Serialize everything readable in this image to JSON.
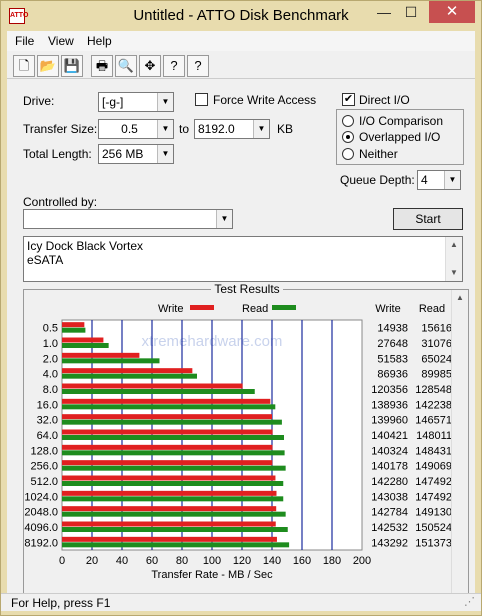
{
  "window": {
    "title": "Untitled - ATTO Disk Benchmark",
    "app_icon_label": "ATTO",
    "minimize_glyph": "—",
    "maximize_glyph": "☐",
    "close_glyph": "✕"
  },
  "menu": [
    "File",
    "View",
    "Help"
  ],
  "toolbar": {
    "icons": [
      "new-icon",
      "open-icon",
      "save-icon",
      "print-icon",
      "print-preview-icon",
      "move-icon",
      "help-icon",
      "context-help-icon"
    ],
    "glyphs": [
      "🗋",
      "📂",
      "💾",
      "🖶",
      "🔍",
      "✥",
      "?",
      "?"
    ]
  },
  "settings": {
    "drive_label": "Drive:",
    "drive_value": "[-g-]",
    "force_write_label": "Force Write Access",
    "force_write_checked": false,
    "direct_io_label": "Direct I/O",
    "direct_io_checked": true,
    "direct_io_check_glyph": "✔",
    "transfer_size_label": "Transfer Size:",
    "transfer_from": "0.5",
    "to_label": "to",
    "transfer_to": "8192.0",
    "kb_label": "KB",
    "total_length_label": "Total Length:",
    "total_length_value": "256 MB",
    "io_options": [
      "I/O Comparison",
      "Overlapped I/O",
      "Neither"
    ],
    "io_selected": "Overlapped I/O",
    "queue_depth_label": "Queue Depth:",
    "queue_depth_value": "4",
    "controlled_by_label": "Controlled by:",
    "controlled_by_value": "",
    "start_label": "Start",
    "description_lines": [
      "Icy Dock Black Vortex",
      "eSATA"
    ]
  },
  "results": {
    "title": "Test Results",
    "write_legend": "Write",
    "read_legend": "Read",
    "write_col": "Write",
    "read_col": "Read",
    "watermark": "xtremehardware.com"
  },
  "chart_data": {
    "type": "bar",
    "title": "Test Results",
    "xlabel": "Transfer Rate - MB / Sec",
    "ylabel": "",
    "xlim": [
      0,
      200
    ],
    "x_ticks": [
      "0",
      "20",
      "40",
      "60",
      "80",
      "100",
      "120",
      "140",
      "160",
      "180",
      "200"
    ],
    "categories": [
      "0.5",
      "1.0",
      "2.0",
      "4.0",
      "8.0",
      "16.0",
      "32.0",
      "64.0",
      "128.0",
      "256.0",
      "512.0",
      "1024.0",
      "2048.0",
      "4096.0",
      "8192.0"
    ],
    "series": [
      {
        "name": "Write",
        "color": "#e02020",
        "values": [
          14.9,
          27.6,
          51.6,
          86.9,
          120.4,
          138.9,
          140.0,
          140.4,
          140.3,
          140.2,
          142.3,
          143.0,
          142.8,
          142.5,
          143.3
        ]
      },
      {
        "name": "Read",
        "color": "#1e8c1e",
        "values": [
          15.6,
          31.1,
          65.0,
          90.0,
          128.5,
          142.2,
          146.6,
          148.0,
          148.4,
          149.1,
          147.5,
          147.5,
          149.1,
          150.5,
          151.4
        ]
      }
    ],
    "write_kb": [
      "14938",
      "27648",
      "51583",
      "86936",
      "120356",
      "138936",
      "139960",
      "140421",
      "140324",
      "140178",
      "142280",
      "143038",
      "142784",
      "142532",
      "143292"
    ],
    "read_kb": [
      "15616",
      "31076",
      "65024",
      "89985",
      "128548",
      "142238",
      "146571",
      "148011",
      "148431",
      "149069",
      "147492",
      "147492",
      "149130",
      "150524",
      "151373"
    ],
    "grid": true,
    "legend": "top"
  },
  "status": {
    "text": "For Help, press F1"
  }
}
